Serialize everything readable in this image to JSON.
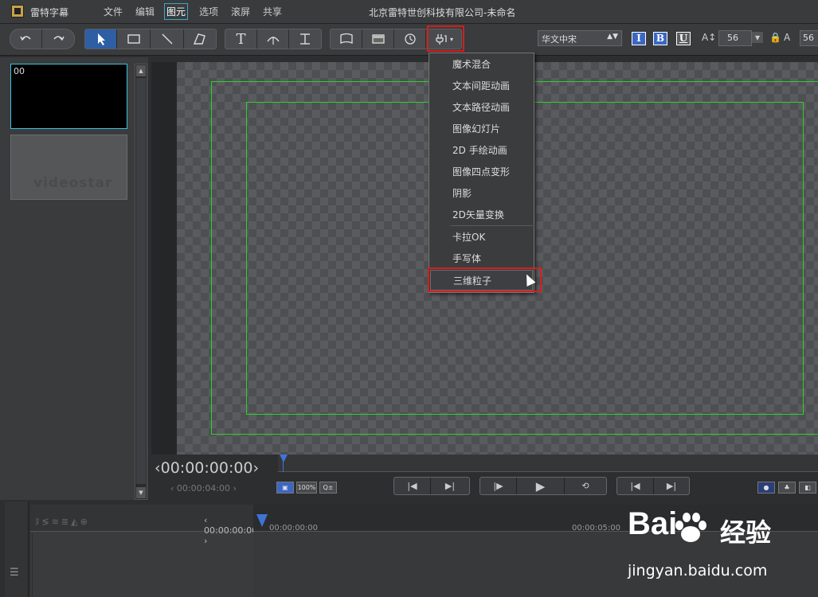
{
  "app": {
    "name": "雷特字幕",
    "window_title": "北京雷特世创科技有限公司-未命名"
  },
  "menu": [
    {
      "label": "文件"
    },
    {
      "label": "编辑"
    },
    {
      "label": "图元"
    },
    {
      "label": "选项"
    },
    {
      "label": "滚屏"
    },
    {
      "label": "共享"
    }
  ],
  "toolbar": {
    "font_name": "华文中宋",
    "italic": "I",
    "bold": "B",
    "underline": "U",
    "font_size": "56",
    "size_partial": "56"
  },
  "thumbnails": [
    {
      "label": "00"
    },
    {
      "label": "videostar"
    }
  ],
  "dropdown": {
    "items": [
      "魔术混合",
      "文本间距动画",
      "文本路径动画",
      "图像幻灯片",
      "2D 手绘动画",
      "图像四点变形",
      "阴影",
      "2D矢量变换",
      "卡拉OK",
      "手写体",
      "三维粒子"
    ],
    "highlighted": "三维粒子"
  },
  "transport": {
    "timecode": "00:00:00:00",
    "sub_timecode": "00:00:04:00",
    "zoom_label": "100%"
  },
  "timeline": {
    "timecode": "00:00:00:00",
    "ruler_start": "00:00:00:00",
    "ruler_mid": "00:00:05:00"
  },
  "watermark": {
    "brand": "Bai",
    "brand2": "经验",
    "url": "jingyan.baidu.com"
  },
  "colors": {
    "accent": "#3aa6d0",
    "highlight_box": "#d0201e",
    "safe_area": "#2bd12b",
    "selected_tool": "#2e5ea3"
  }
}
